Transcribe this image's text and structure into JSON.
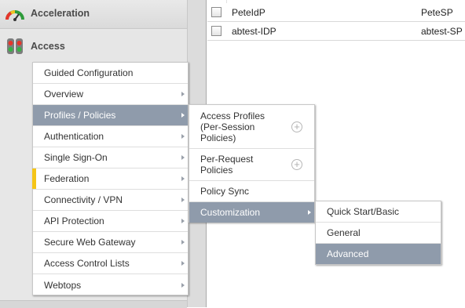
{
  "nav": {
    "acceleration_label": "Acceleration",
    "access_label": "Access"
  },
  "table": {
    "rows": [
      {
        "name": "PeteIdP",
        "sp": "PeteSP"
      },
      {
        "name": "abtest-IDP",
        "sp": "abtest-SP"
      }
    ]
  },
  "menu1": {
    "items": [
      {
        "label": "Guided Configuration"
      },
      {
        "label": "Overview"
      },
      {
        "label": "Profiles / Policies"
      },
      {
        "label": "Authentication"
      },
      {
        "label": "Single Sign-On"
      },
      {
        "label": "Federation"
      },
      {
        "label": "Connectivity / VPN"
      },
      {
        "label": "API Protection"
      },
      {
        "label": "Secure Web Gateway"
      },
      {
        "label": "Access Control Lists"
      },
      {
        "label": "Webtops"
      }
    ]
  },
  "menu2": {
    "items": [
      {
        "label": "Access Profiles (Per-Session Policies)",
        "plus": "+"
      },
      {
        "label": "Per-Request Policies",
        "plus": "+"
      },
      {
        "label": "Policy Sync"
      },
      {
        "label": "Customization"
      }
    ]
  },
  "menu3": {
    "items": [
      {
        "label": "Quick Start/Basic"
      },
      {
        "label": "General"
      },
      {
        "label": "Advanced"
      }
    ]
  },
  "colors": {
    "active_item": "#8f9bab",
    "flag": "#f5c518"
  },
  "icons": {
    "acceleration": "gauge-icon",
    "access": "traffic-lights-icon",
    "submenu": "chevron-right-icon",
    "create": "plus-circle-icon"
  }
}
